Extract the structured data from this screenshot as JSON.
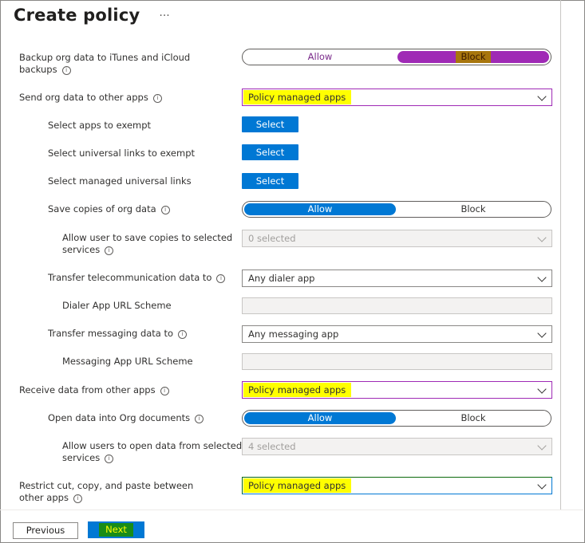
{
  "header": {
    "title": "Create policy",
    "more": "···"
  },
  "settings": {
    "backup": {
      "label_line1": "Backup org data to iTunes and iCloud",
      "label_line2": "backups",
      "allow": "Allow",
      "block": "Block"
    },
    "send": {
      "label": "Send org data to other apps",
      "value": "Policy managed apps"
    },
    "exempt_apps": {
      "label": "Select apps to exempt",
      "button": "Select"
    },
    "exempt_links": {
      "label": "Select universal links to exempt",
      "button": "Select"
    },
    "managed_links": {
      "label": "Select managed universal links",
      "button": "Select"
    },
    "save_copies": {
      "label": "Save copies of org data",
      "allow": "Allow",
      "block": "Block"
    },
    "save_services": {
      "label_line1": "Allow user to save copies to selected",
      "label_line2": "services",
      "value": "0 selected"
    },
    "telecom": {
      "label": "Transfer telecommunication data to",
      "value": "Any dialer app"
    },
    "dialer_url": {
      "label": "Dialer App URL Scheme",
      "value": ""
    },
    "messaging": {
      "label": "Transfer messaging data to",
      "value": "Any messaging app"
    },
    "messaging_url": {
      "label": "Messaging App URL Scheme",
      "value": ""
    },
    "receive": {
      "label": "Receive data from other apps",
      "value": "Policy managed apps"
    },
    "open_data": {
      "label": "Open data into Org documents",
      "allow": "Allow",
      "block": "Block"
    },
    "open_services": {
      "label_line1": "Allow users to open data from selected",
      "label_line2": "services",
      "value": "4 selected"
    },
    "cut_copy": {
      "label_line1": "Restrict cut, copy, and paste between",
      "label_line2": "other apps",
      "value": "Policy managed apps"
    }
  },
  "footer": {
    "previous": "Previous",
    "next": "Next"
  },
  "colors": {
    "accent": "#0078d4",
    "purple": "#9f2ab5",
    "highlight": "#ffff00"
  },
  "icons": {
    "info": "info-icon",
    "chevron": "chevron-down-icon",
    "more": "more-icon"
  }
}
